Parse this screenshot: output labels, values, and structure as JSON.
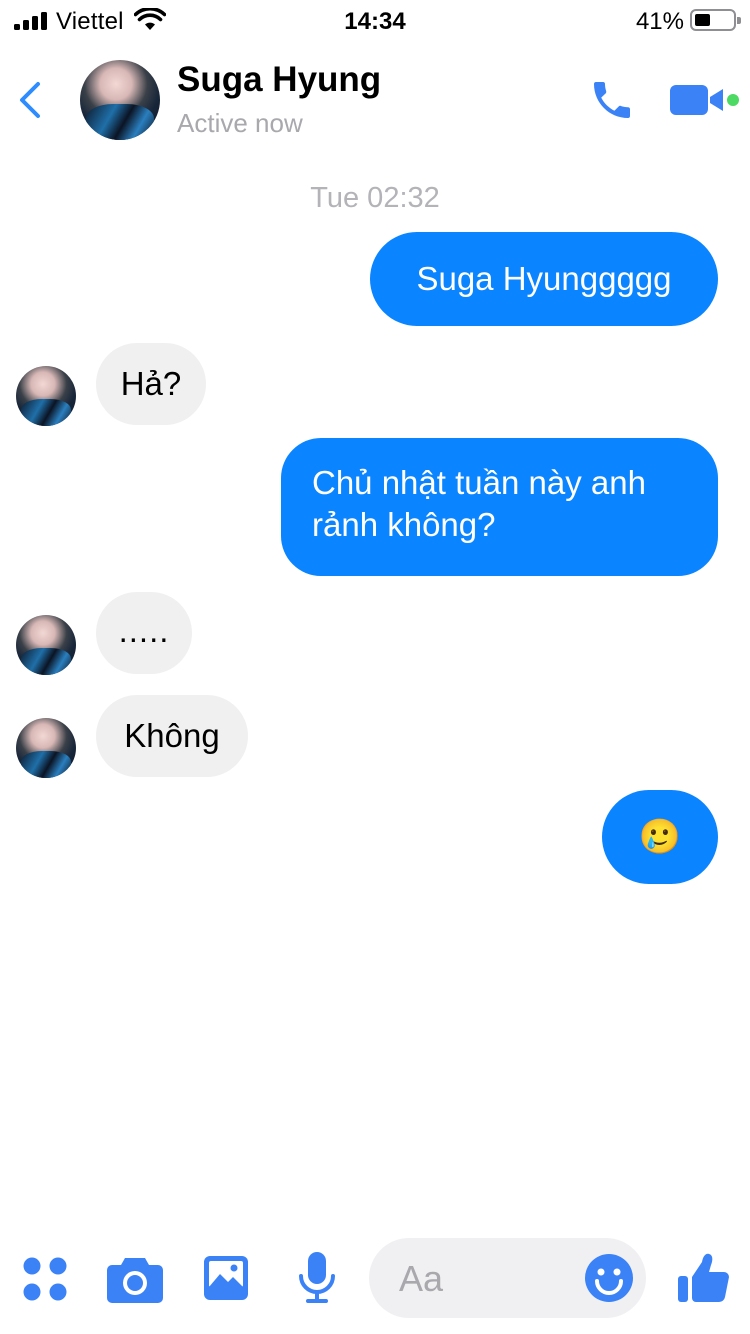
{
  "status_bar": {
    "carrier": "Viettel",
    "time": "14:34",
    "battery_percent": "41%",
    "battery_level": 0.41
  },
  "header": {
    "contact_name": "Suga Hyung",
    "contact_status": "Active now",
    "active_indicator_color": "#4cd964"
  },
  "colors": {
    "accent": "#0a84ff",
    "icon_blue": "#3b82f6",
    "incoming_bubble": "#f0f0f0"
  },
  "conversation": {
    "timestamp": "Tue 02:32",
    "messages": [
      {
        "direction": "out",
        "text": "Suga Hyunggggg"
      },
      {
        "direction": "in",
        "text": "Hả?"
      },
      {
        "direction": "out",
        "text": "Chủ nhật tuần này anh rảnh không?"
      },
      {
        "direction": "in",
        "text": "....."
      },
      {
        "direction": "in",
        "text": "Không"
      },
      {
        "direction": "out",
        "text": "🥲"
      }
    ]
  },
  "composer": {
    "placeholder": "Aa",
    "icons": [
      "apps-icon",
      "camera-icon",
      "photo-icon",
      "microphone-icon",
      "emoji-icon",
      "thumbs-up-icon"
    ]
  }
}
